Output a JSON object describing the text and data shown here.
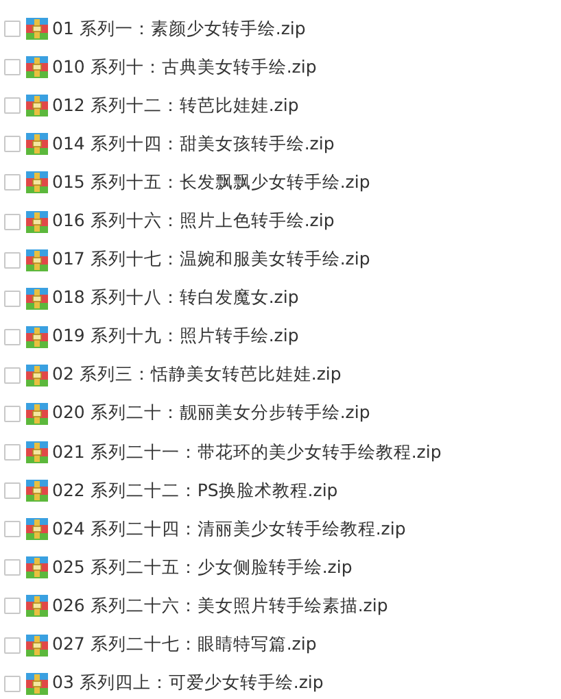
{
  "files": [
    {
      "name": "01 系列一：素颜少女转手绘.zip",
      "checked": false
    },
    {
      "name": "010 系列十：古典美女转手绘.zip",
      "checked": false
    },
    {
      "name": "012 系列十二：转芭比娃娃.zip",
      "checked": false
    },
    {
      "name": "014 系列十四：甜美女孩转手绘.zip",
      "checked": false
    },
    {
      "name": "015 系列十五：长发飘飘少女转手绘.zip",
      "checked": false
    },
    {
      "name": "016 系列十六：照片上色转手绘.zip",
      "checked": false
    },
    {
      "name": "017 系列十七：温婉和服美女转手绘.zip",
      "checked": false
    },
    {
      "name": "018 系列十八：转白发魔女.zip",
      "checked": false
    },
    {
      "name": "019 系列十九：照片转手绘.zip",
      "checked": false
    },
    {
      "name": "02 系列三：恬静美女转芭比娃娃.zip",
      "checked": false
    },
    {
      "name": "020 系列二十：靓丽美女分步转手绘.zip",
      "checked": false
    },
    {
      "name": "021 系列二十一：带花环的美少女转手绘教程.zip",
      "checked": false
    },
    {
      "name": "022 系列二十二：PS换脸术教程.zip",
      "checked": false
    },
    {
      "name": "024 系列二十四：清丽美少女转手绘教程.zip",
      "checked": false
    },
    {
      "name": "025 系列二十五：少女侧脸转手绘.zip",
      "checked": false
    },
    {
      "name": "026 系列二十六：美女照片转手绘素描.zip",
      "checked": false
    },
    {
      "name": "027 系列二十七：眼睛特写篇.zip",
      "checked": false
    },
    {
      "name": "03 系列四上：可爱少女转手绘.zip",
      "checked": false
    }
  ]
}
